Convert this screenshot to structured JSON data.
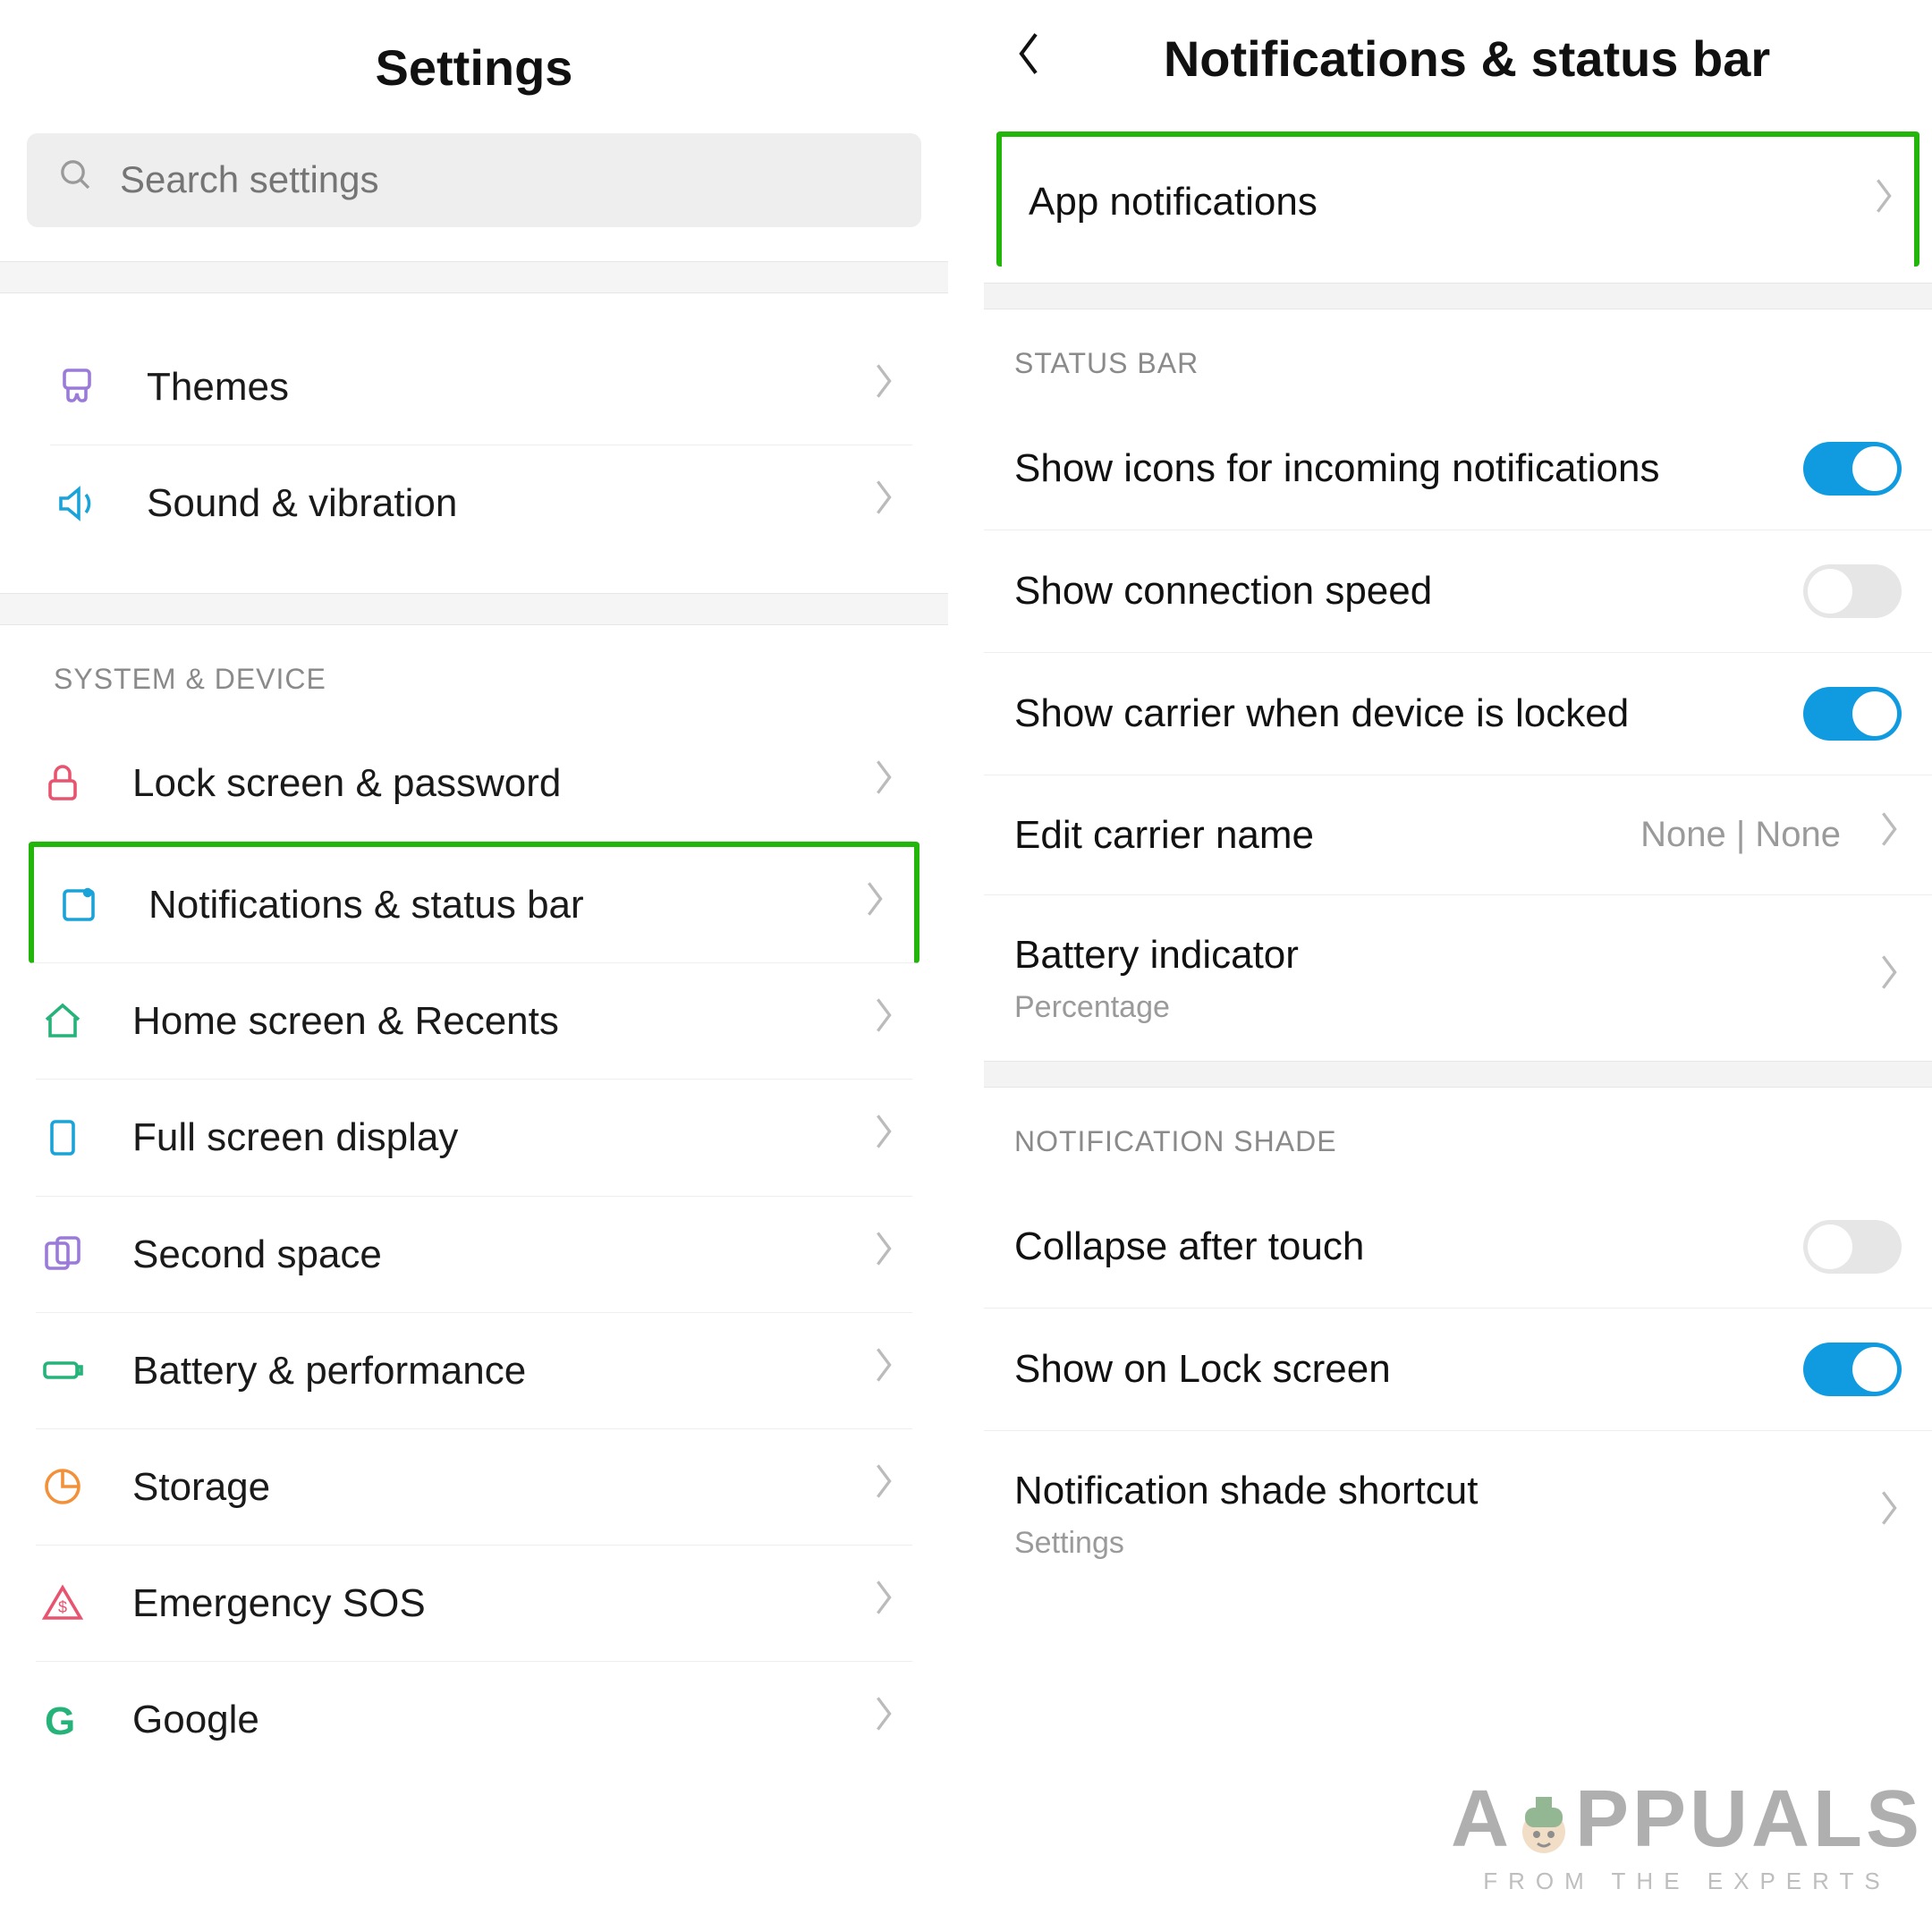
{
  "left": {
    "title": "Settings",
    "search_placeholder": "Search settings",
    "section1_label": "SYSTEM & DEVICE",
    "group0": [
      {
        "label": "Themes",
        "icon": "themes"
      },
      {
        "label": "Sound & vibration",
        "icon": "sound"
      }
    ],
    "group1": [
      {
        "label": "Lock screen & password",
        "icon": "lock"
      },
      {
        "label": "Notifications & status bar",
        "icon": "notif",
        "highlight": true
      },
      {
        "label": "Home screen & Recents",
        "icon": "home"
      },
      {
        "label": "Full screen display",
        "icon": "display"
      },
      {
        "label": "Second space",
        "icon": "second"
      },
      {
        "label": "Battery & performance",
        "icon": "battery"
      },
      {
        "label": "Storage",
        "icon": "storage"
      },
      {
        "label": "Emergency SOS",
        "icon": "sos"
      },
      {
        "label": "Google",
        "icon": "google"
      }
    ]
  },
  "right": {
    "title": "Notifications & status bar",
    "app_notifications": "App notifications",
    "status_bar_label": "STATUS BAR",
    "notification_shade_label": "NOTIFICATION SHADE",
    "rows": {
      "show_icons": {
        "title": "Show icons for incoming notifications",
        "on": true
      },
      "show_speed": {
        "title": "Show connection speed",
        "on": false
      },
      "show_carrier": {
        "title": "Show carrier when device is locked",
        "on": true
      },
      "edit_carrier": {
        "title": "Edit carrier name",
        "value": "None | None"
      },
      "battery_ind": {
        "title": "Battery indicator",
        "sub": "Percentage"
      },
      "collapse": {
        "title": "Collapse after touch",
        "on": false
      },
      "show_lock": {
        "title": "Show on Lock screen",
        "on": true
      },
      "shade_shortcut": {
        "title": "Notification shade shortcut",
        "sub": "Settings"
      }
    }
  },
  "watermark": {
    "big_a": "A",
    "big_rest": "PPUALS",
    "sub": "FROM THE EXPERTS"
  }
}
